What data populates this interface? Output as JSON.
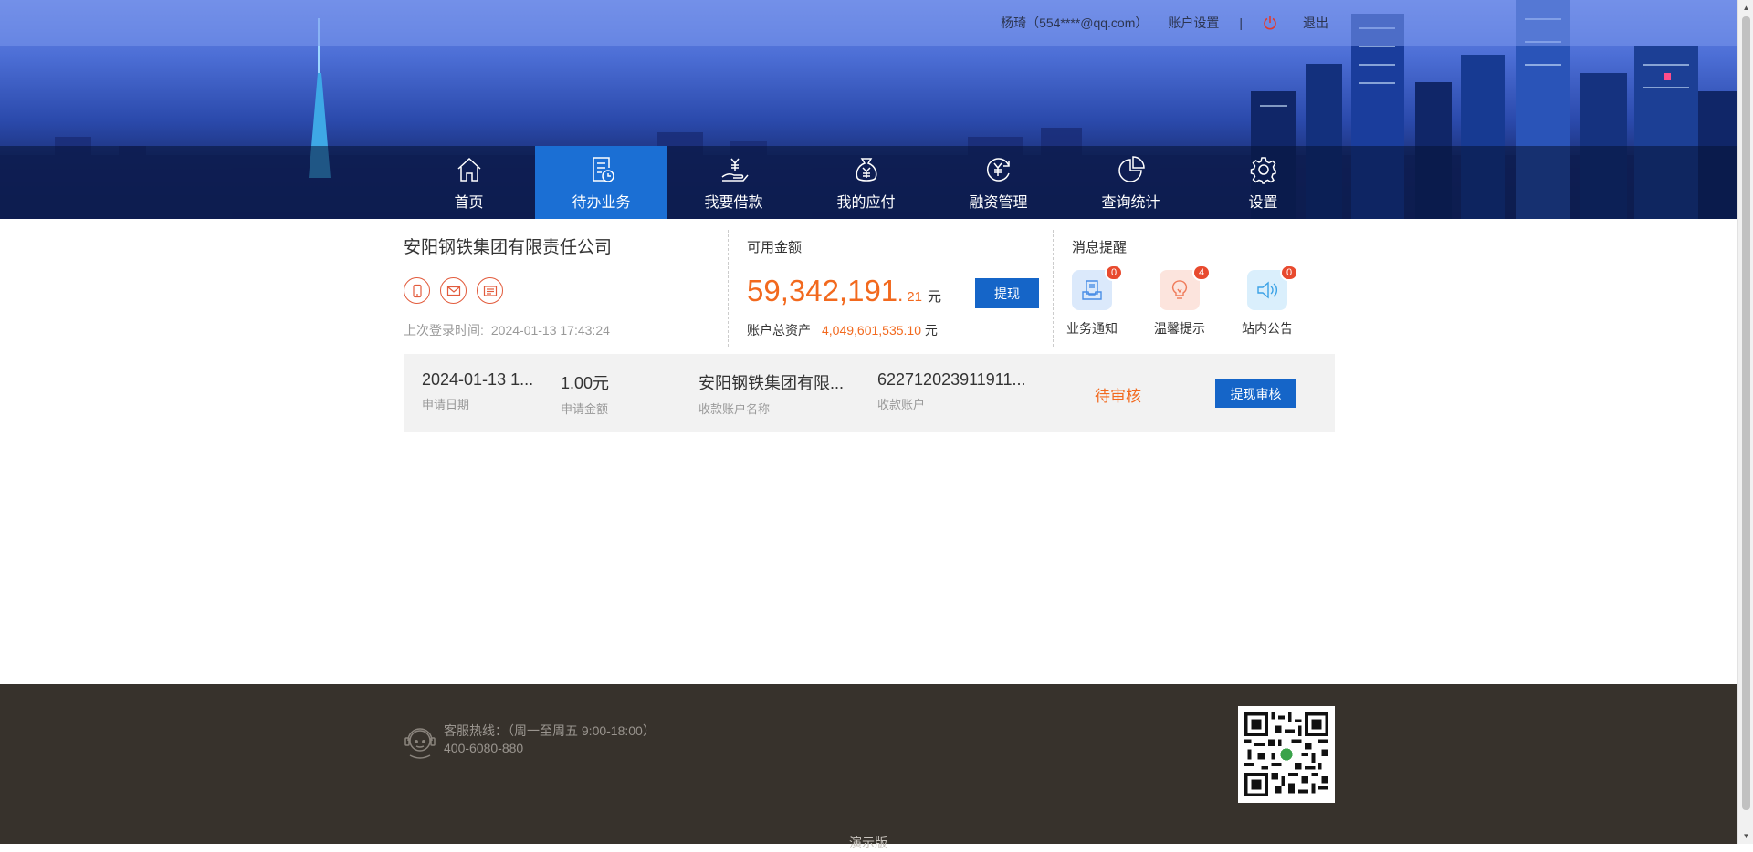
{
  "header": {
    "user": "杨琦（554****@qq.com）",
    "account_settings": "账户设置",
    "separator": "|",
    "logout": "退出"
  },
  "nav": {
    "items": [
      {
        "label": "首页",
        "icon": "home-icon"
      },
      {
        "label": "待办业务",
        "icon": "todo-document-icon",
        "active": true
      },
      {
        "label": "我要借款",
        "icon": "loan-hand-icon"
      },
      {
        "label": "我的应付",
        "icon": "money-bag-icon"
      },
      {
        "label": "融资管理",
        "icon": "yen-cycle-icon"
      },
      {
        "label": "查询统计",
        "icon": "pie-chart-icon"
      },
      {
        "label": "设置",
        "icon": "gear-icon"
      }
    ]
  },
  "company": {
    "name": "安阳钢铁集团有限责任公司",
    "contact_icons": [
      "phone-icon",
      "email-icon",
      "id-card-icon"
    ],
    "last_login_label": "上次登录时间:",
    "last_login_time": "2024-01-13 17:43:24"
  },
  "balance": {
    "label": "可用金额",
    "amount_int": "59,342,191",
    "amount_dot": ".",
    "amount_dec": "21",
    "unit": "元",
    "withdraw_button": "提现",
    "total_assets_label": "账户总资产",
    "total_assets_value": "4,049,601,535.10",
    "total_assets_unit": "元"
  },
  "messages": {
    "label": "消息提醒",
    "items": [
      {
        "label": "业务通知",
        "count": "0",
        "icon": "business-notice-icon"
      },
      {
        "label": "温馨提示",
        "count": "4",
        "icon": "lightbulb-icon"
      },
      {
        "label": "站内公告",
        "count": "0",
        "icon": "speaker-icon"
      }
    ]
  },
  "pending": {
    "date_value": "2024-01-13 1...",
    "date_label": "申请日期",
    "amount_value": "1.00元",
    "amount_label": "申请金额",
    "account_name_value": "安阳钢铁集团有限...",
    "account_name_label": "收款账户名称",
    "account_value": "622712023911911...",
    "account_label": "收款账户",
    "status": "待审核",
    "action_button": "提现审核"
  },
  "footer": {
    "hotline_label": "客服热线：（周一至周五 9:00-18:00）",
    "hotline_phone": "400-6080-880",
    "bottom_text": "演示版"
  },
  "colors": {
    "primary_blue": "#1565c8",
    "accent_orange": "#f2691e",
    "footer_bg": "#37322c"
  }
}
